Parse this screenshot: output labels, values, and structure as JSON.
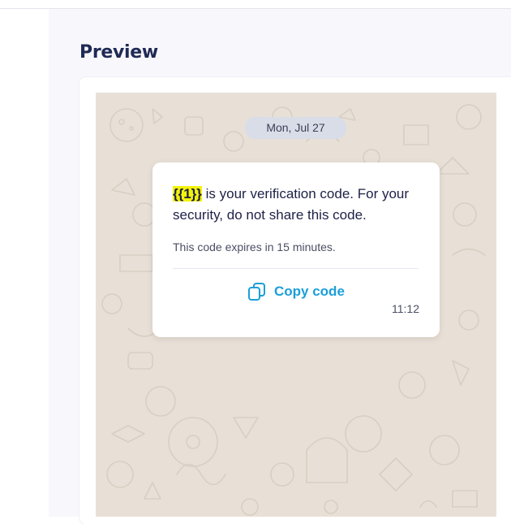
{
  "preview": {
    "title": "Preview"
  },
  "chat": {
    "date_label": "Mon, Jul 27",
    "message": {
      "placeholder": "{{1}}",
      "body_rest": " is your verification code. For your security, do not share this code.",
      "footer": "This code expires in 15 minutes.",
      "button_label": "Copy code",
      "button_icon": "copy-icon",
      "time": "11:12"
    }
  },
  "colors": {
    "title": "#1f2a55",
    "chat_background": "#e8e0d6",
    "link": "#1b9fd8",
    "placeholder_highlight": "#f4f20a"
  }
}
